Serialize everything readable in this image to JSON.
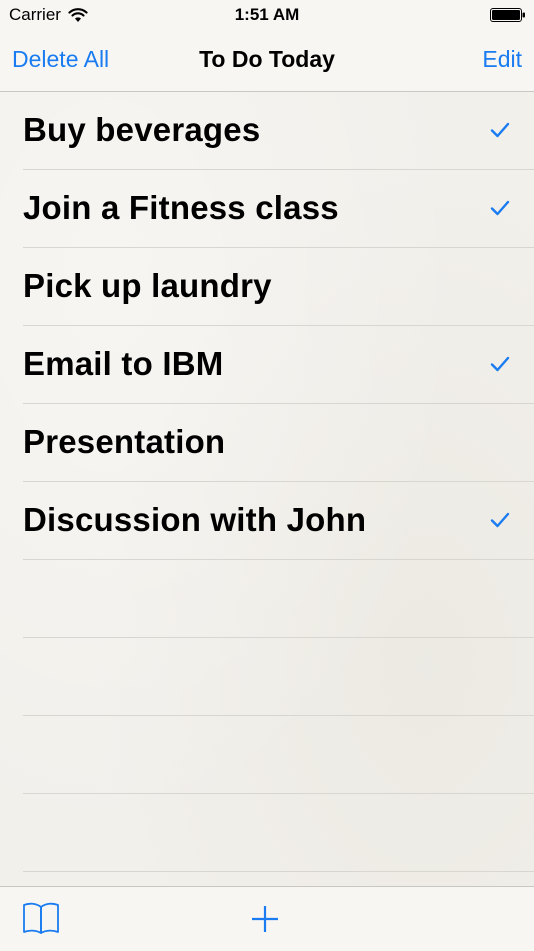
{
  "status_bar": {
    "carrier": "Carrier",
    "time": "1:51 AM",
    "icons": [
      "wifi-icon",
      "battery-icon"
    ]
  },
  "nav": {
    "left_label": "Delete All",
    "title": "To Do Today",
    "right_label": "Edit"
  },
  "tasks": [
    {
      "label": "Buy beverages",
      "done": true
    },
    {
      "label": "Join a Fitness class",
      "done": true
    },
    {
      "label": "Pick up laundry",
      "done": false
    },
    {
      "label": "Email to IBM",
      "done": true
    },
    {
      "label": "Presentation",
      "done": false
    },
    {
      "label": "Discussion with John",
      "done": true
    }
  ],
  "toolbar": {
    "icons": [
      "book-icon",
      "add-icon"
    ]
  },
  "colors": {
    "accent": "#1a7cf0",
    "background": "#f2f0eb",
    "separator": "#d8d6d1"
  }
}
